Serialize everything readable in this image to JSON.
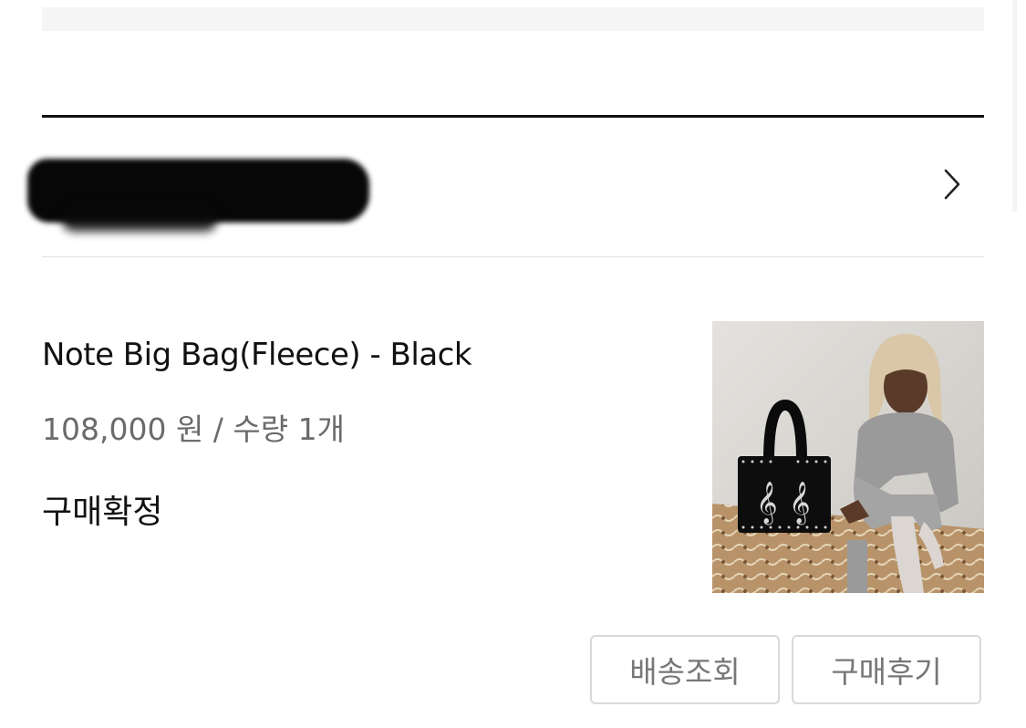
{
  "order": {
    "number_hidden": "redacted-order-number"
  },
  "product": {
    "name": "Note Big Bag(Fleece) - Black",
    "price_line": "108,000 원 / 수량 1개",
    "status": "구매확정"
  },
  "actions": {
    "tracking_label": "배송조회",
    "review_label": "구매후기"
  },
  "icons": {
    "chevron": "chevron-right-icon"
  },
  "colors": {
    "text_primary": "#111111",
    "text_secondary": "#6b6b6b",
    "button_border": "#d9d9d9",
    "button_text": "#777777"
  }
}
